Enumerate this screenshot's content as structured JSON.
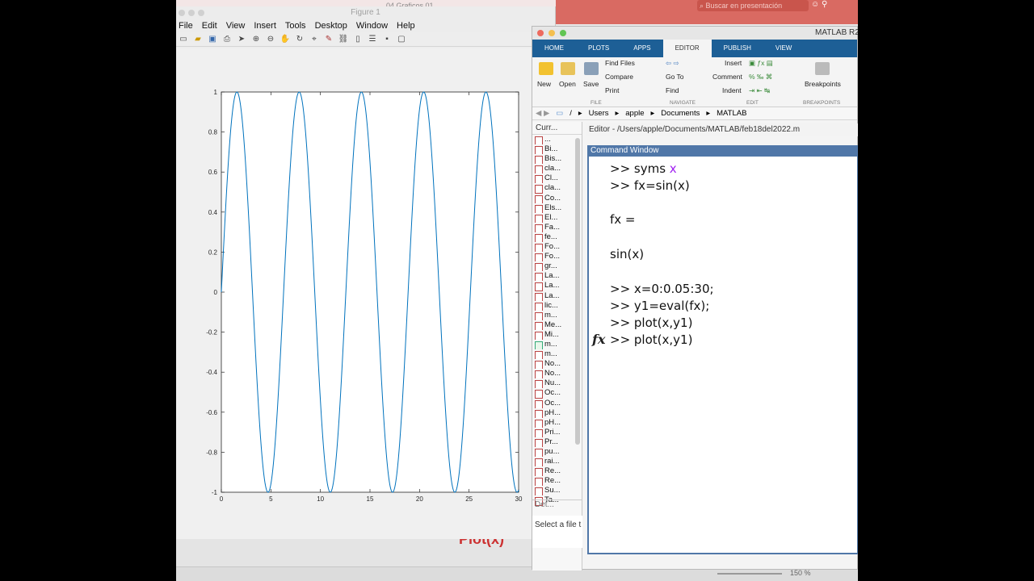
{
  "background_app": {
    "title": "04 Graficos 01",
    "search_placeholder": "Buscar en presentación",
    "slide_text": "Plot(x) ",
    "zoom": "150 %"
  },
  "figure_window": {
    "title": "Figure 1",
    "menu": [
      "File",
      "Edit",
      "View",
      "Insert",
      "Tools",
      "Desktop",
      "Window",
      "Help"
    ],
    "toolbar_icons": [
      "new-icon",
      "open-icon",
      "save-icon",
      "print-icon",
      "pointer-icon",
      "zoom-in-icon",
      "zoom-out-icon",
      "pan-icon",
      "rotate-icon",
      "data-cursor-icon",
      "brush-icon",
      "link-icon",
      "colorbar-icon",
      "legend-icon",
      "hide-tools-icon",
      "dock-icon"
    ]
  },
  "chart_data": {
    "type": "line",
    "title": "",
    "xlabel": "",
    "ylabel": "",
    "xlim": [
      0,
      30
    ],
    "ylim": [
      -1,
      1
    ],
    "xticks": [
      0,
      5,
      10,
      15,
      20,
      25,
      30
    ],
    "yticks": [
      -1,
      -0.8,
      -0.6,
      -0.4,
      -0.2,
      0,
      0.2,
      0.4,
      0.6,
      0.8,
      1
    ],
    "xtick_labels": [
      "0",
      "5",
      "10",
      "15",
      "20",
      "25",
      "30"
    ],
    "ytick_labels": [
      "-1",
      "-0.8",
      "-0.6",
      "-0.4",
      "-0.2",
      "0",
      "0.2",
      "0.4",
      "0.6",
      "0.8",
      "1"
    ],
    "grid": false,
    "series": [
      {
        "function": "sin(x)",
        "x_start": 0,
        "x_step": 0.05,
        "x_end": 30,
        "color": "#0072bd"
      }
    ]
  },
  "matlab": {
    "title": "MATLAB R2",
    "tabs": [
      "HOME",
      "PLOTS",
      "APPS",
      "EDITOR",
      "PUBLISH",
      "VIEW"
    ],
    "active_tab": "EDITOR",
    "ribbon": {
      "new": "New",
      "open": "Open",
      "save": "Save",
      "find_files": "Find Files",
      "compare": "Compare",
      "print": "Print",
      "go_to": "Go To",
      "find": "Find",
      "insert": "Insert",
      "comment": "Comment",
      "indent": "Indent",
      "breakpoints": "Breakpoints",
      "sections": {
        "file": "FILE",
        "navigate": "NAVIGATE",
        "edit": "EDIT",
        "breakpoints": "BREAKPOINTS"
      }
    },
    "address": [
      "/",
      "Users",
      "apple",
      "Documents",
      "MATLAB"
    ],
    "folder": {
      "header": "Curr...",
      "files": [
        "...",
        "Bi...",
        "Bis...",
        "cla...",
        "Cl...",
        "cla...",
        "Co...",
        "Els...",
        "El...",
        "Fa...",
        "fe...",
        "Fo...",
        "Fo...",
        "gr...",
        "La...",
        "La...",
        "La...",
        "lic...",
        "m...",
        "Me...",
        "Mi...",
        "m...",
        "m...",
        "No...",
        "No...",
        "Nu...",
        "Oc...",
        "Oc...",
        "pH...",
        "pH...",
        "Pri...",
        "Pr...",
        "pu...",
        "rai...",
        "Re...",
        "Re...",
        "Su...",
        "Ta..."
      ],
      "details": "Det...",
      "select_file": "Select a file t"
    },
    "editor_path": "Editor - /Users/apple/Documents/MATLAB/feb18del2022.m",
    "command_window": {
      "title": "Command Window",
      "lines": [
        {
          "prefix": ">> syms ",
          "kw": "x",
          "rest": ""
        },
        {
          "prefix": ">> fx=sin(x)",
          "kw": "",
          "rest": ""
        },
        {
          "prefix": "fx =",
          "kw": "",
          "rest": ""
        },
        {
          "prefix": "sin(x)",
          "kw": "",
          "rest": ""
        },
        {
          "prefix": ">> x=0:0.05:30;",
          "kw": "",
          "rest": ""
        },
        {
          "prefix": ">> y1=eval(fx);",
          "kw": "",
          "rest": ""
        },
        {
          "prefix": ">> plot(x,y1)",
          "kw": "",
          "rest": ""
        },
        {
          "prefix": ">> plot(x,y1)",
          "kw": "",
          "rest": ""
        }
      ],
      "fx_glyph": "fx"
    }
  }
}
